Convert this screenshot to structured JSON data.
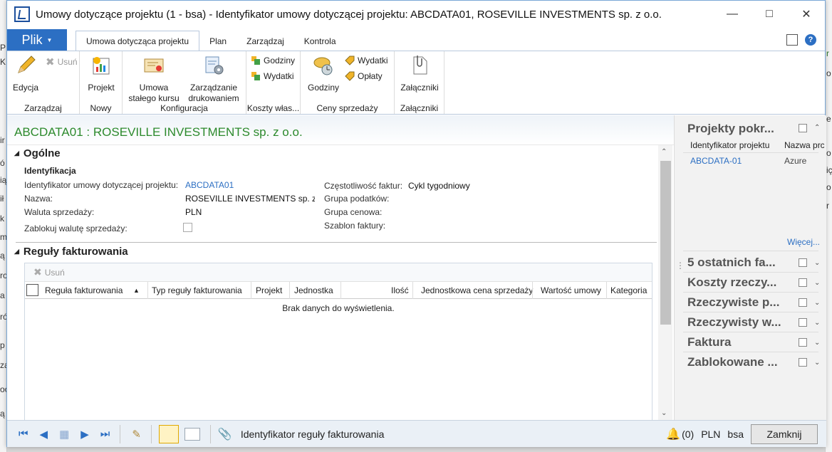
{
  "window": {
    "title": "Umowy dotyczące projektu (1 - bsa) - Identyfikator umowy dotyczącej projektu: ABCDATA01, ROSEVILLE INVESTMENTS sp. z o.o."
  },
  "background": {
    "left_fragments": [
      "P",
      "K",
      "ir",
      "ó",
      "ią",
      "ił",
      "k",
      "m",
      "ą",
      "ro",
      "a",
      "ró",
      "p",
      "zą",
      "oc",
      "ą",
      "ią"
    ],
    "right_fragments": [
      "r",
      "o",
      "e",
      "o",
      "iç",
      "o",
      "r"
    ]
  },
  "ribbon": {
    "file_label": "Plik",
    "tabs": [
      "Umowa dotycząca projektu",
      "Plan",
      "Zarządzaj",
      "Kontrola"
    ],
    "groups": {
      "zarzadzaj": {
        "label": "Zarządzaj",
        "edit": "Edycja",
        "delete": "Usuń"
      },
      "nowy": {
        "label": "Nowy",
        "project": "Projekt"
      },
      "konfiguracja": {
        "label": "Konfiguracja",
        "fixed_rate": "Umowa\nstałego kursu",
        "print_mgmt": "Zarządzanie\ndrukowaniem"
      },
      "koszty": {
        "label": "Koszty włas...",
        "hours": "Godziny",
        "expenses": "Wydatki"
      },
      "ceny": {
        "label": "Ceny sprzedaży",
        "hours": "Godziny",
        "expenses": "Wydatki",
        "fees": "Opłaty"
      },
      "zalaczniki": {
        "label": "Załączniki",
        "attachments": "Załączniki"
      }
    }
  },
  "record": {
    "title": "ABCDATA01 : ROSEVILLE INVESTMENTS sp. z o.o.",
    "general": {
      "heading": "Ogólne",
      "subheading": "Identyfikacja",
      "id_label": "Identyfikator umowy dotyczącej projektu:",
      "id_value": "ABCDATA01",
      "name_label": "Nazwa:",
      "name_value": "ROSEVILLE INVESTMENTS sp. z o.c",
      "currency_label": "Waluta sprzedaży:",
      "currency_value": "PLN",
      "lock_label": "Zablokuj walutę sprzedaży:",
      "freq_label": "Częstotliwość faktur:",
      "freq_value": "Cykl tygodniowy",
      "tax_label": "Grupa podatków:",
      "price_label": "Grupa cenowa:",
      "template_label": "Szablon faktury:"
    },
    "billing": {
      "heading": "Reguły fakturowania",
      "delete": "Usuń",
      "columns": [
        "Reguła fakturowania",
        "Typ reguły fakturowania",
        "Projekt",
        "Jednostka",
        "Ilość",
        "Jednostkowa cena sprzedaży",
        "Wartość umowy",
        "Kategoria"
      ],
      "empty": "Brak danych do wyświetlenia."
    }
  },
  "factbox": {
    "main_title": "Projekty pokr...",
    "col1": "Identyfikator projektu",
    "col2": "Nazwa prc",
    "row_id": "ABCDATA-01",
    "row_name": "Azure",
    "more": "Więcej...",
    "panes": [
      "5 ostatnich fa...",
      "Koszty rzeczy...",
      "Rzeczywiste p...",
      "Rzeczywisty w...",
      "Faktura",
      "Zablokowane ..."
    ]
  },
  "statusbar": {
    "field_help": "Identyfikator reguły fakturowania",
    "notifications": "(0)",
    "currency": "PLN",
    "company": "bsa",
    "close": "Zamknij"
  }
}
